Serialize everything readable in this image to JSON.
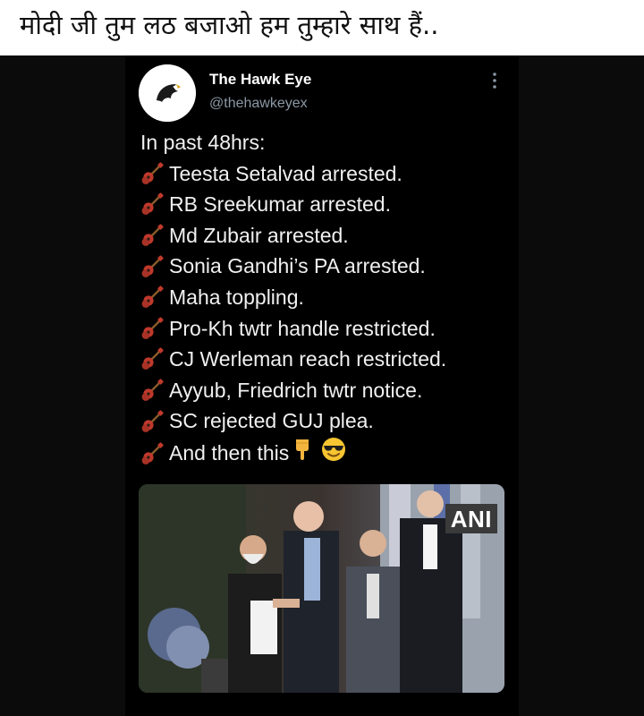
{
  "caption": "मोदी जी तुम लठ बजाओ हम तुम्हारे साथ हैं..",
  "tweet": {
    "author_name": "The Hawk Eye",
    "author_handle": "@thehawkeyex",
    "intro": "In past 48hrs:",
    "bullet_icon": "guitar-icon",
    "items": [
      "Teesta Setalvad arrested.",
      "RB Sreekumar arrested.",
      "Md Zubair arrested.",
      "Sonia Gandhi’s PA arrested.",
      "Maha toppling.",
      "Pro-Kh twtr handle restricted.",
      "CJ Werleman reach restricted.",
      "Ayyub, Friedrich twtr notice.",
      "SC rejected GUJ plea.",
      "And then this"
    ],
    "tail_icons": [
      "pointing-down-icon",
      "sunglasses-face-icon"
    ],
    "photo_watermark": "ANI"
  },
  "colors": {
    "background": "#000000",
    "text": "#f0f0f0",
    "handle": "#8b98a5"
  }
}
